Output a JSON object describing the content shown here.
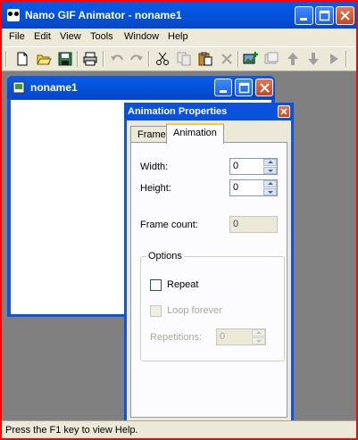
{
  "window": {
    "title": "Namo GIF Animator - noname1",
    "icon": "cartoon-face-icon",
    "controls": [
      "minimize-icon",
      "maximize-icon",
      "close-icon"
    ]
  },
  "menu": [
    "File",
    "Edit",
    "View",
    "Tools",
    "Window",
    "Help"
  ],
  "toolbar": {
    "buttons": [
      "new-icon",
      "open-icon",
      "save-icon",
      "print-icon",
      "undo-icon",
      "redo-icon",
      "cut-icon",
      "copy-icon",
      "paste-icon",
      "delete-icon",
      "insert-frame-icon",
      "frame-properties-icon",
      "move-up-icon",
      "move-down-icon",
      "play-icon"
    ]
  },
  "child_window": {
    "title": "noname1",
    "icon": "document-icon"
  },
  "dialog": {
    "title": "Animation Properties",
    "tabs": [
      "Frame",
      "Animation"
    ],
    "active_tab": "Animation",
    "width_label": "Width:",
    "width_value": "0",
    "height_label": "Height:",
    "height_value": "0",
    "frame_count_label": "Frame count:",
    "frame_count_value": "0",
    "options_label": "Options",
    "repeat_label": "Repeat",
    "repeat_checked": false,
    "loop_forever_label": "Loop forever",
    "loop_forever_checked": false,
    "repetitions_label": "Repetitions:",
    "repetitions_value": "0"
  },
  "status": {
    "text": "Press the F1 key to view Help."
  },
  "colors": {
    "title_bar": "#0355dd",
    "close_button": "#c9441f",
    "workspace": "#808080",
    "face": "#ece9d8",
    "frame_highlight": "#ff0000"
  }
}
